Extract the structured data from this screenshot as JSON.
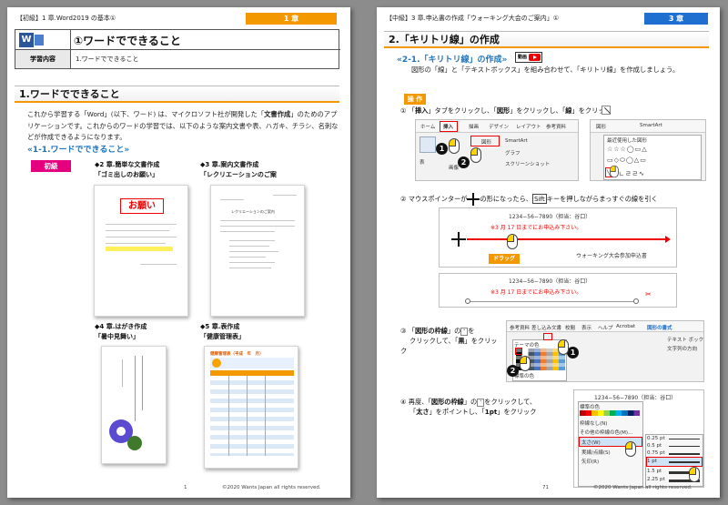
{
  "left_page": {
    "header": "【初級】1 章.Word2019 の基本①",
    "chapter_badge": "1 章",
    "title_icon": "W",
    "title": "①ワードでできること",
    "learning_label": "学習内容",
    "learning_item": "1.ワードでできること",
    "section_title": "1.ワードでできること",
    "intro": "これから学習する「Word」(以下、ワード) は、マイクロソフト社が開発した「文書作成」のためのアプリケーションです。これからのワードの学習では、以下のような案内文書や表、ハガキ、チラシ、名刺などが作成できるようになります。",
    "intro_parts": {
      "a": "これから学習する「Word」(以下、ワード) は、マイクロソフト社が開発した「",
      "b": "文書作成",
      "c": "」のためのアプリケーションです。これからのワードの学習では、以下のような案内文書や表、ハガキ、チラシ、名刺などが作成できるようになります。"
    },
    "subsection": "«1-1.ワードでできること»",
    "level_badge": "初級",
    "examples": [
      {
        "chapter": "◆2 章.簡単な文書作成",
        "name": "「ゴミ出しのお願い」"
      },
      {
        "chapter": "◆3 章.案内文書作成",
        "name": "「レクリエーションのご案"
      },
      {
        "chapter": "◆4 章.はがき作成",
        "name": "「暑中見舞い」"
      },
      {
        "chapter": "◆5 章.表作成",
        "name": "「健康管理表」"
      }
    ],
    "thumb_texts": {
      "onegai": "お願い",
      "recreation": "レクリエーションのご案内",
      "health": "健康管理表（平成　年　月）"
    },
    "page_number": "1",
    "copyright": "©2020 Wants Japan all rights reserved."
  },
  "right_page": {
    "header": "【中級】3 章.申込書の作成「ウォーキング大会のご案内」①",
    "chapter_badge": "3 章",
    "section_title": "2.「キリトリ線」の作成",
    "subsection": "«2-1.「キリトリ線」の作成»",
    "video_label": "動画",
    "intro": "図形の「線」と「テキストボックス」を組み合わせて、「キリトリ線」を作成しましょう。",
    "operation_label": "操 作",
    "steps": [
      {
        "num": "①",
        "a": "「",
        "b": "挿入",
        "c": "」タブをクリックし、「",
        "d": "図形",
        "e": "」をクリックし、「",
        "f": "線",
        "g": "」をクリック"
      },
      {
        "num": "②",
        "a": "マウスポインターが",
        "b": "の形になったら、",
        "c": "Sift",
        "d": "キーを押しながらまっすぐの線を引く"
      },
      {
        "num": "③",
        "a": "「",
        "b": "図形の枠線",
        "c": "」の",
        "d": "を",
        "e": "クリックして、「",
        "f": "黒",
        "g": "」をクリック"
      },
      {
        "num": "④",
        "a": "再度、「",
        "b": "図形の枠線",
        "c": "」の",
        "d": "をクリックして、",
        "e": "「",
        "f": "太さ",
        "g": "」をポイントし、「",
        "h": "1pt",
        "i": "」をクリック"
      }
    ],
    "ribbon_tabs": [
      "ホーム",
      "挿入",
      "描画",
      "デザイン",
      "レイアウト",
      "参考資料"
    ],
    "ribbon_labels": {
      "shape": "図形",
      "smartart": "SmartArt",
      "graph": "グラフ",
      "screenshot": "スクリーンショット",
      "image": "画像",
      "table": "表",
      "recent": "最近使用した図形",
      "smartart2": "SmartArt"
    },
    "step2_texts": {
      "phone": "1234−56−7890（担当：谷口）",
      "deadline": "※3 月 17 日までにお申込み下さい。",
      "applicant": "ウォーキング大会参加申込書",
      "drag": "ドラッグ"
    },
    "step3_tabs": [
      "参考資料",
      "差し込み文書",
      "校閲",
      "表示",
      "ヘルプ",
      "Acrobat",
      "図形の書式"
    ],
    "step3_labels": {
      "theme_colors": "テーマの色",
      "standard_colors": "標準の色",
      "text_box": "テキスト ボックス",
      "text_direction": "文字列の方向"
    },
    "step4_labels": {
      "standard_colors": "標準の色",
      "no_line": "枠線なし(N)",
      "other_colors": "その他の枠線の色(M)...",
      "weight": "太さ(W)",
      "dash": "実線/点線(S)",
      "arrow": "矢印(R)",
      "phone": "1234−56−7890（担当：谷口）",
      "weights": [
        "0.25 pt",
        "0.5 pt",
        "0.75 pt",
        "1 pt",
        "1.5 pt",
        "2.25 pt"
      ]
    },
    "page_number": "71",
    "copyright": "©2020 Wants Japan all rights reserved."
  },
  "colors": {
    "orange": "#f39800",
    "blue": "#1e73be",
    "red": "#e00000",
    "yellow": "#ffef5a"
  }
}
